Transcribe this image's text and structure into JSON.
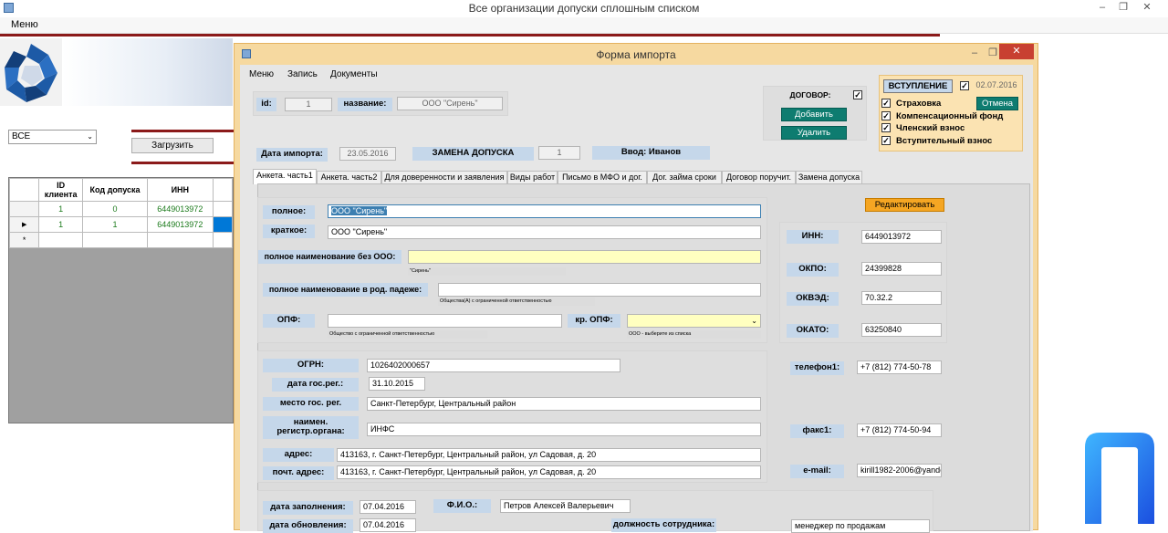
{
  "main_window": {
    "title": "Все организации допуски сплошным списком",
    "menu": "Меню",
    "filter_value": "ВСЕ",
    "load_button": "Загрузить",
    "grid": {
      "headers": [
        "ID клиента",
        "Код допуска",
        "ИНН"
      ],
      "rows": [
        [
          "1",
          "0",
          "6449013972"
        ],
        [
          "1",
          "1",
          "6449013972"
        ]
      ],
      "new_row_marker": "*",
      "current_row_marker": "▶"
    }
  },
  "form": {
    "title": "Форма импорта",
    "menu": [
      "Меню",
      "Запись",
      "Документы"
    ],
    "id_label": "id:",
    "id_value": "1",
    "name_label": "название:",
    "name_value": "ООО \"Сирень\"",
    "import_date_label": "Дата импорта:",
    "import_date_value": "23.05.2016",
    "replace_label": "ЗАМЕНА ДОПУСКА",
    "replace_value": "1",
    "entered_by": "Ввод: Иванов",
    "contract_label": "ДОГОВОР:",
    "contract_checked": "✓",
    "add_button": "Добавить",
    "delete_button": "Удалить",
    "entry_label": "ВСТУПЛЕНИЕ",
    "entry_checked": "✓",
    "entry_date": "02.07.2016",
    "cancel_button": "Отмена",
    "checks": [
      {
        "label": "Страховка",
        "mark": "✓"
      },
      {
        "label": "Компенсационный фонд",
        "mark": "✓"
      },
      {
        "label": "Членский взнос",
        "mark": "✓"
      },
      {
        "label": "Вступительный взнос",
        "mark": "✓"
      }
    ],
    "tabs": [
      "Анкета. часть1",
      "Анкета. часть2",
      "Для доверенности и заявления",
      "Виды работ",
      "Письмо в МФО и дог.",
      "Дог. займа сроки",
      "Договор поручит.",
      "Замена допуска"
    ],
    "edit_button": "Редактировать",
    "fields": {
      "full_label": "полное:",
      "full_value": "ООО \"Сирень\"",
      "short_label": "краткое:",
      "short_value": "ООО \"Сирень\"",
      "no_ooo_label": "полное наименование без ООО:",
      "no_ooo_value": "",
      "no_ooo_hint": "\"Сирень\"",
      "genitive_label": "полное наименование в род. падеже:",
      "genitive_value": "",
      "genitive_hint": "Общества(А) с ограниченной ответственностью",
      "opf_label": "ОПФ:",
      "opf_value": "",
      "opf_hint": "Общество с ограниченной ответственностью",
      "kr_opf_label": "кр. ОПФ:",
      "kr_opf_value": "",
      "kr_opf_hint": "ООО - выберите из списка",
      "inn_label": "ИНН:",
      "inn_value": "6449013972",
      "okpo_label": "ОКПО:",
      "okpo_value": "24399828",
      "okved_label": "ОКВЭД:",
      "okved_value": "70.32.2",
      "okato_label": "ОКАТО:",
      "okato_value": "63250840",
      "ogrn_label": "ОГРН:",
      "ogrn_value": "1026402000657",
      "reg_date_label": "дата гос.рег.:",
      "reg_date_value": "31.10.2015",
      "reg_place_label": "место гос. рег.",
      "reg_place_value": "Санкт-Петербург, Центральный район",
      "reg_org_label_1": "наимен.",
      "reg_org_label_2": "регистр.органа:",
      "reg_org_value": "ИНФС",
      "address_label": "адрес:",
      "address_value": "413163, г. Санкт-Петербург, Центральный район, ул Садовая, д. 20",
      "postal_label": "почт. адрес:",
      "postal_value": "413163, г. Санкт-Петербург, Центральный район, ул Садовая, д. 20",
      "phone_label": "телефон1:",
      "phone_value": "+7 (812) 774-50-78",
      "fax_label": "факс1:",
      "fax_value": "+7 (812) 774-50-94",
      "email_label": "e-mail:",
      "email_value": "kirill1982-2006@yande",
      "fill_date_label": "дата заполнения:",
      "fill_date_value": "07.04.2016",
      "update_date_label": "дата обновления:",
      "update_date_value": "07.04.2016",
      "fio_label": "Ф.И.О.:",
      "fio_value": "Петров Алексей Валерьевич",
      "position_label": "должность сотрудника:",
      "position_value": "менеджер по продажам"
    }
  },
  "colors": {
    "form_frame": "#f6d9a0",
    "label_bg": "#c5d7ea",
    "teal_button": "#0e7c70",
    "edit_button": "#f5a623",
    "highlight_input": "#ffffc0",
    "brand_red": "#8b1a1a",
    "close_button": "#c84031"
  }
}
